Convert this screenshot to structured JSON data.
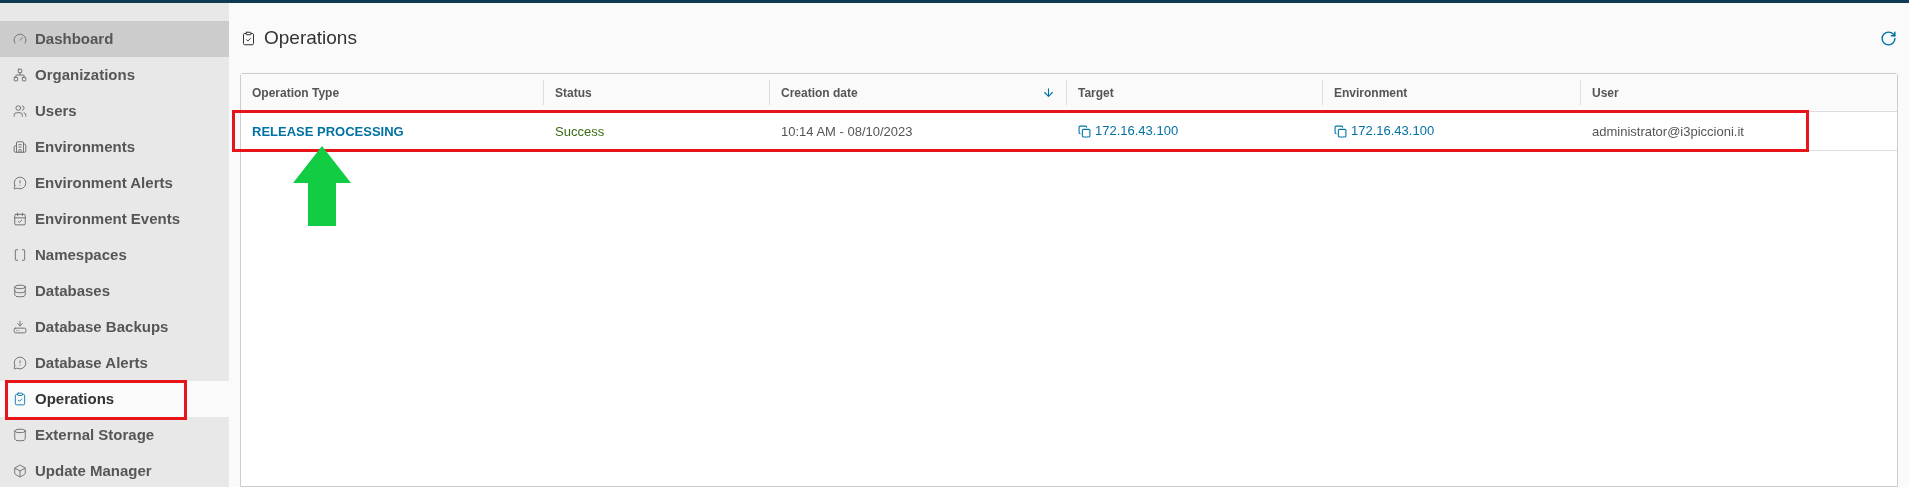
{
  "sidebar": {
    "items": [
      {
        "label": "Dashboard",
        "selected": false,
        "hovered": true
      },
      {
        "label": "Organizations",
        "selected": false,
        "hovered": false
      },
      {
        "label": "Users",
        "selected": false,
        "hovered": false
      },
      {
        "label": "Environments",
        "selected": false,
        "hovered": false
      },
      {
        "label": "Environment Alerts",
        "selected": false,
        "hovered": false
      },
      {
        "label": "Environment Events",
        "selected": false,
        "hovered": false
      },
      {
        "label": "Namespaces",
        "selected": false,
        "hovered": false
      },
      {
        "label": "Databases",
        "selected": false,
        "hovered": false
      },
      {
        "label": "Database Backups",
        "selected": false,
        "hovered": false
      },
      {
        "label": "Database Alerts",
        "selected": false,
        "hovered": false
      },
      {
        "label": "Operations",
        "selected": true,
        "hovered": false
      },
      {
        "label": "External Storage",
        "selected": false,
        "hovered": false
      },
      {
        "label": "Update Manager",
        "selected": false,
        "hovered": false
      }
    ]
  },
  "page": {
    "title": "Operations"
  },
  "table": {
    "columns": [
      {
        "label": "Operation Type",
        "sorted_descending": false
      },
      {
        "label": "Status",
        "sorted_descending": false
      },
      {
        "label": "Creation date",
        "sorted_descending": true
      },
      {
        "label": "Target",
        "sorted_descending": false
      },
      {
        "label": "Environment",
        "sorted_descending": false
      },
      {
        "label": "User",
        "sorted_descending": false
      }
    ],
    "rows": [
      {
        "operation_type": "RELEASE PROCESSING",
        "status": "Success",
        "creation_date": "10:14 AM - 08/10/2023",
        "target": "172.16.43.100",
        "environment": "172.16.43.100",
        "user": "administrator@i3piccioni.it"
      }
    ]
  }
}
